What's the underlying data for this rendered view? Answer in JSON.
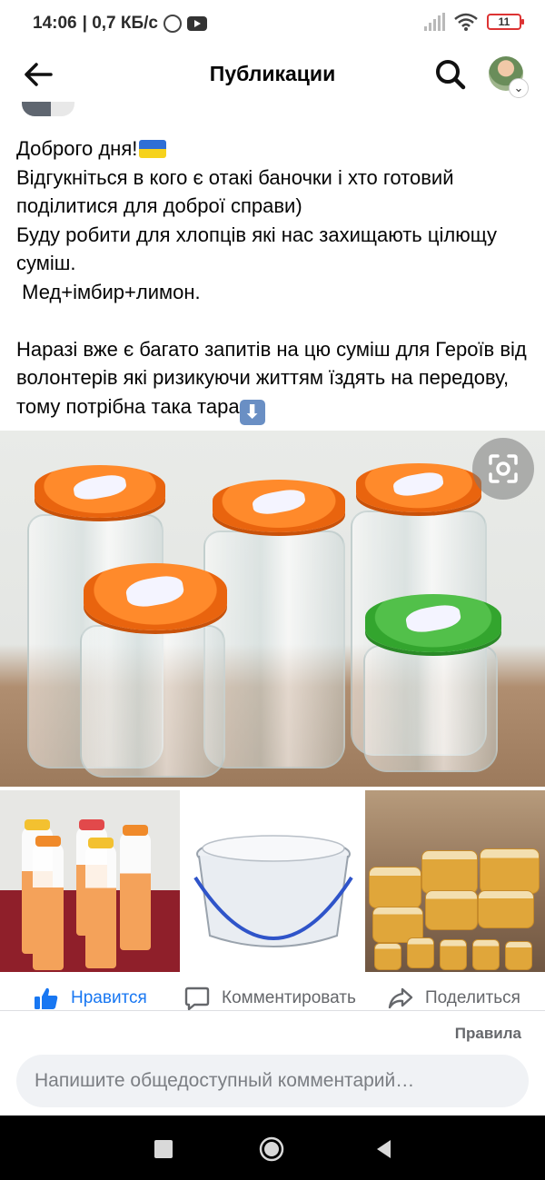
{
  "status": {
    "time": "14:06",
    "speed": "| 0,7 КБ/с",
    "battery": "11"
  },
  "appbar": {
    "title": "Публикации"
  },
  "post": {
    "line1": "Доброго дня!",
    "text_a": "Відгукніться в кого є отакі баночки і хто готовий поділитися для доброї справи)\nБуду робити для хлопців які нас захищають цілющу суміш.\n Мед+імбир+лимон.\n\nНаразі вже є багато запитів на цю суміш для Героїв від волонтерів які ризикуючи життям їздять на передову, тому потрібна така тара"
  },
  "actions": {
    "like": "Нравится",
    "comment": "Комментировать",
    "share": "Поделиться"
  },
  "rules_label": "Правила",
  "comment_box": {
    "placeholder": "Напишите общедоступный комментарий…"
  },
  "icons": {
    "back": "arrow-left-icon",
    "search": "search-icon",
    "lens": "visual-search-icon",
    "like": "thumbs-up-icon",
    "comment": "comment-icon",
    "share": "share-icon"
  },
  "colors": {
    "accent": "#1877f2",
    "lid_orange": "#ff7a1a",
    "lid_green": "#3fb23a"
  }
}
